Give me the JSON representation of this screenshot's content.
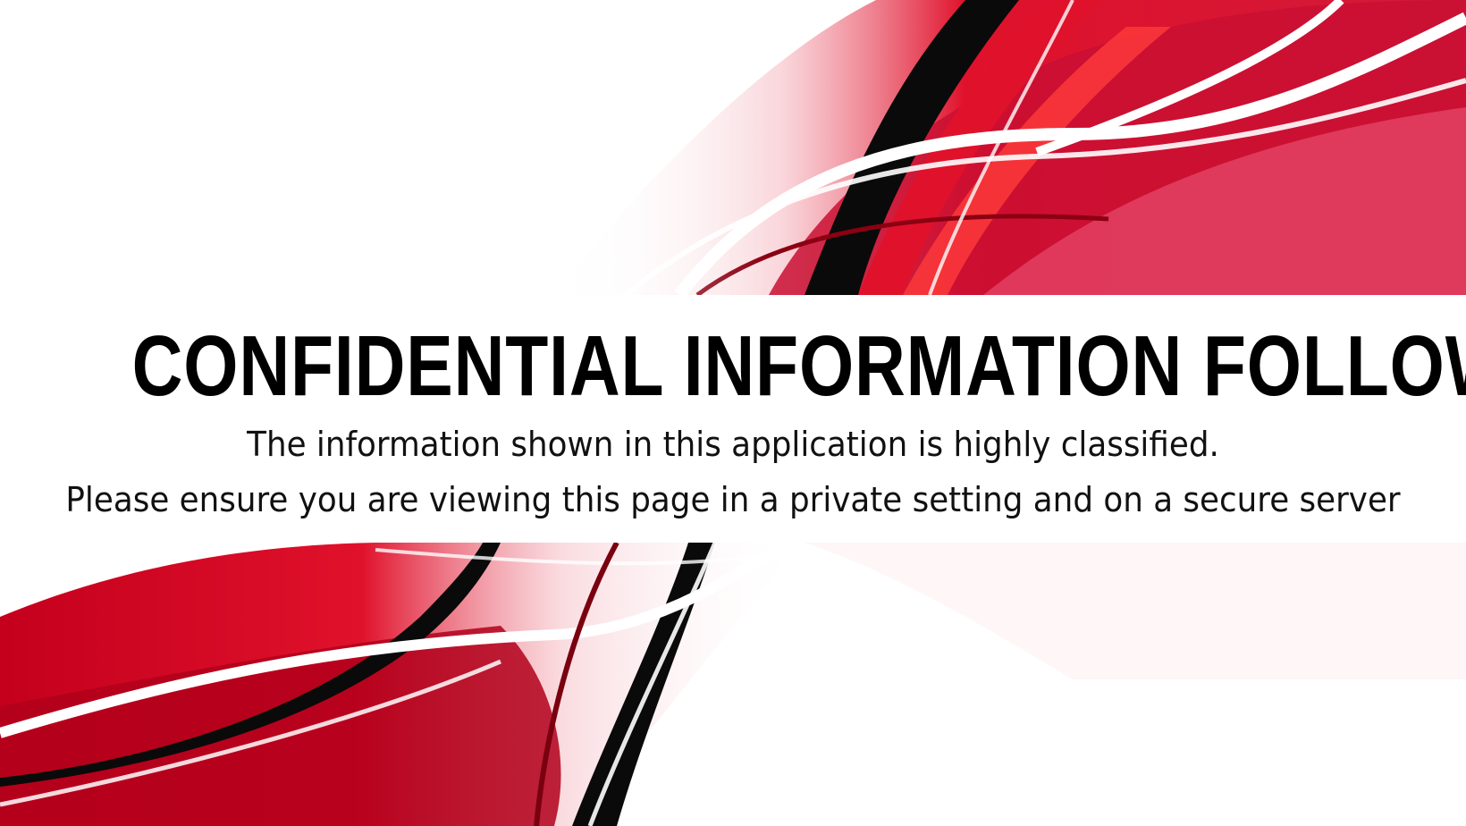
{
  "banner": {
    "headline": "CONFIDENTIAL INFORMATION FOLLOWING...",
    "line1": "The information shown in this application is highly classified.",
    "line2": "Please ensure you are viewing this page in a private setting and on a secure server"
  },
  "background": {
    "description_icon": "abstract-red-swoosh-icon",
    "colors": {
      "red_dark": "#a8001a",
      "red": "#e0112b",
      "red_light": "#f06a7a",
      "pink": "#f7c5cc",
      "black": "#0a0a0a",
      "white": "#ffffff"
    }
  }
}
